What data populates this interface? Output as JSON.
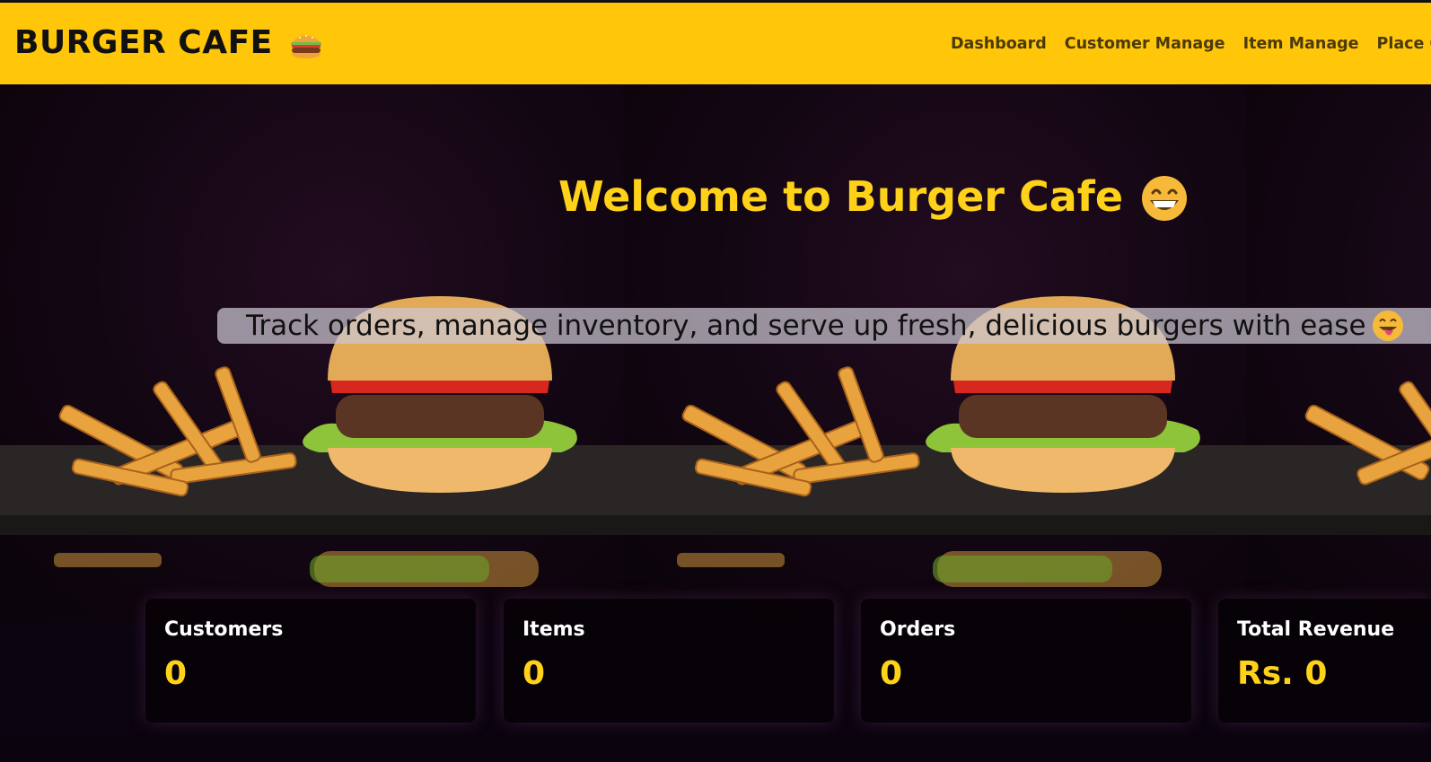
{
  "brand": {
    "name": "BURGER CAFE",
    "icon": "burger-icon"
  },
  "nav": {
    "items": [
      "Dashboard",
      "Customer Manage",
      "Item Manage",
      "Place O"
    ]
  },
  "hero": {
    "title": "Welcome to Burger Cafe",
    "title_emoji": "grinning-face-icon",
    "tagline": "Track orders, manage inventory, and serve up fresh, delicious burgers with ease",
    "tagline_emoji": "tongue-out-face-icon"
  },
  "stats": [
    {
      "label": "Customers",
      "value": "0"
    },
    {
      "label": "Items",
      "value": "0"
    },
    {
      "label": "Orders",
      "value": "0"
    },
    {
      "label": "Total Revenue",
      "value": "Rs. 0"
    }
  ],
  "colors": {
    "navbar": "#ffc60a",
    "accent": "#ffd21a",
    "card_bg": "#080208"
  }
}
